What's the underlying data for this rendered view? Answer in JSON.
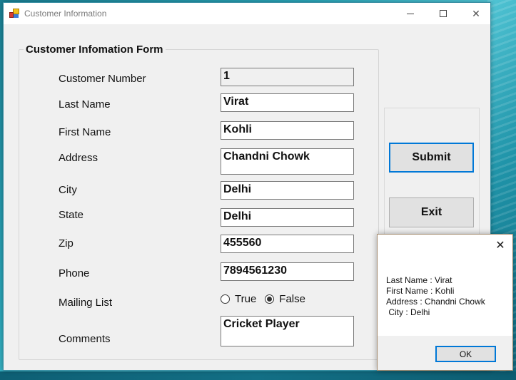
{
  "window": {
    "title": "Customer Information",
    "icon": "winforms-app-icon",
    "controls": {
      "minimize": "minimize-icon",
      "maximize": "maximize-icon",
      "close": "close-icon"
    }
  },
  "form": {
    "group_title": "Customer Infomation Form",
    "fields": [
      {
        "label": "Customer Number",
        "value": "1",
        "readonly": true
      },
      {
        "label": "Last Name",
        "value": "Virat"
      },
      {
        "label": "First Name",
        "value": "Kohli"
      },
      {
        "label": "Address",
        "value": "Chandni Chowk"
      },
      {
        "label": "City",
        "value": "Delhi"
      },
      {
        "label": "State",
        "value": "Delhi"
      },
      {
        "label": "Zip",
        "value": "455560"
      },
      {
        "label": "Phone",
        "value": "7894561230"
      },
      {
        "label": "Comments",
        "value": "Cricket Player"
      }
    ],
    "mailing_list": {
      "label": "Mailing List",
      "options": [
        {
          "label": "True",
          "checked": false
        },
        {
          "label": "False",
          "checked": true
        }
      ]
    }
  },
  "buttons": {
    "submit": "Submit",
    "exit": "Exit"
  },
  "message_box": {
    "text": "Last Name : Virat\nFirst Name : Kohli\nAddress : Chandni Chowk\n City : Delhi",
    "ok_label": "OK",
    "close_glyph": "✕"
  },
  "colors": {
    "focus_border": "#0078d7",
    "window_bg": "#f0f0f0"
  }
}
